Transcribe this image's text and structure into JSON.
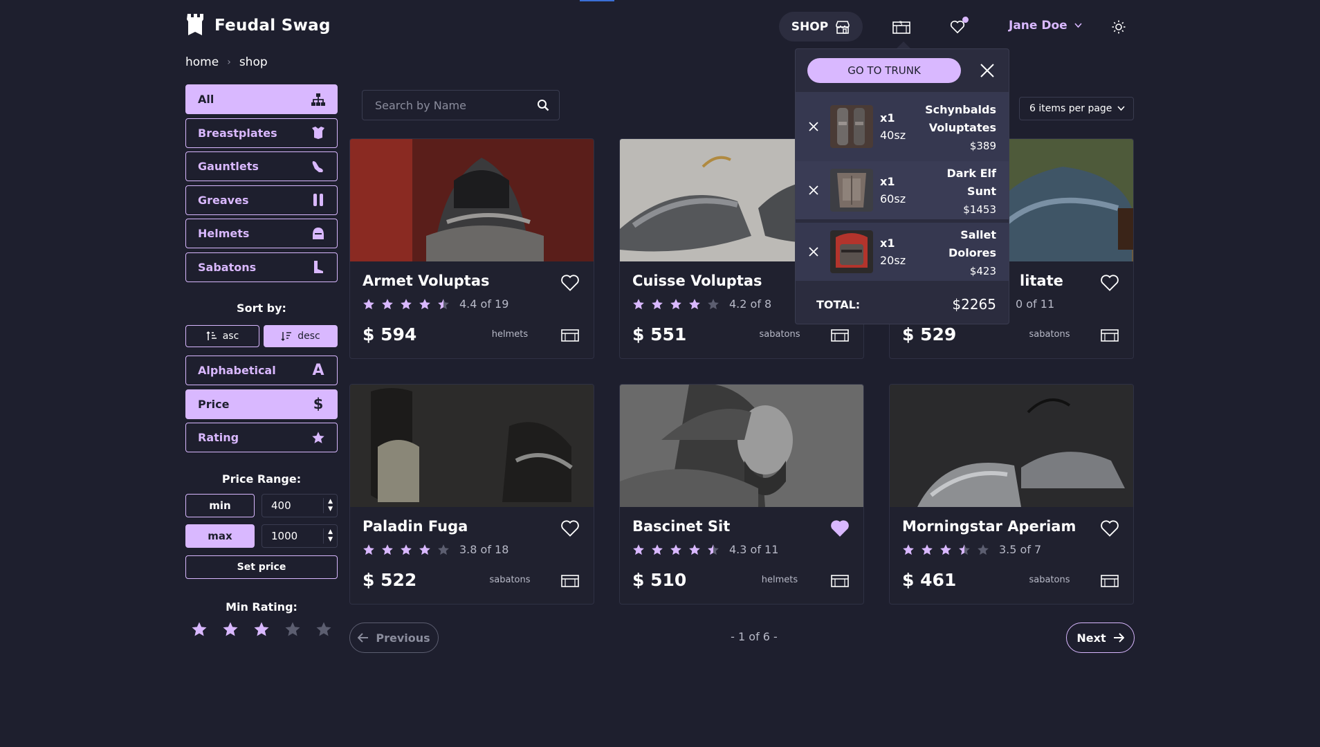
{
  "header": {
    "logo_text": "Feudal Swag",
    "shop_label": "SHOP",
    "trunk_count": "3",
    "user_name": "Jane Doe"
  },
  "breadcrumb": [
    "home",
    "shop"
  ],
  "categories": [
    {
      "label": "All",
      "icon": "hierarchy-icon",
      "active": true
    },
    {
      "label": "Breastplates",
      "icon": "breastplate-icon",
      "active": false
    },
    {
      "label": "Gauntlets",
      "icon": "gauntlet-icon",
      "active": false
    },
    {
      "label": "Greaves",
      "icon": "greaves-icon",
      "active": false
    },
    {
      "label": "Helmets",
      "icon": "helmet-icon",
      "active": false
    },
    {
      "label": "Sabatons",
      "icon": "boot-icon",
      "active": false
    }
  ],
  "sort": {
    "title": "Sort by:",
    "asc_label": "asc",
    "desc_label": "desc",
    "direction": "desc",
    "options": [
      {
        "label": "Alphabetical",
        "icon": "letter-a-icon",
        "active": false
      },
      {
        "label": "Price",
        "icon": "dollar-icon",
        "active": true
      },
      {
        "label": "Rating",
        "icon": "star-icon",
        "active": false
      }
    ]
  },
  "price_range": {
    "title": "Price Range:",
    "min_label": "min",
    "max_label": "max",
    "min_value": "400",
    "max_value": "1000",
    "set_label": "Set price"
  },
  "min_rating": {
    "title": "Min Rating:",
    "value": 3,
    "max": 5
  },
  "search": {
    "placeholder": "Search by Name"
  },
  "per_page": {
    "selected": "6 items per page"
  },
  "products": [
    {
      "name": "Armet Voluptas",
      "rating": 4.4,
      "rating_text": "4.4 of 19",
      "price": "$ 594",
      "category": "helmets",
      "favorite": false
    },
    {
      "name": "Cuisse Voluptas",
      "rating": 4.2,
      "rating_text": "4.2 of 8",
      "price": "$ 551",
      "category": "sabatons",
      "favorite": false
    },
    {
      "name": "litate",
      "rating": 0,
      "rating_text": "0 of 11",
      "price": "$ 529",
      "category": "sabatons",
      "favorite": false
    },
    {
      "name": "Paladin Fuga",
      "rating": 3.8,
      "rating_text": "3.8 of 18",
      "price": "$ 522",
      "category": "sabatons",
      "favorite": false
    },
    {
      "name": "Bascinet Sit",
      "rating": 4.3,
      "rating_text": "4.3 of 11",
      "price": "$ 510",
      "category": "helmets",
      "favorite": true
    },
    {
      "name": "Morningstar Aperiam",
      "rating": 3.5,
      "rating_text": "3.5 of 7",
      "price": "$ 461",
      "category": "sabatons",
      "favorite": false
    }
  ],
  "pagination": {
    "prev_label": "Previous",
    "next_label": "Next",
    "info": "- 1 of 6 -"
  },
  "trunk": {
    "goto_label": "GO TO TRUNK",
    "items": [
      {
        "qty": "x1",
        "size": "40sz",
        "name": "Schynbalds Voluptates",
        "price": "$389"
      },
      {
        "qty": "x1",
        "size": "60sz",
        "name": "Dark Elf Sunt",
        "price": "$1453"
      },
      {
        "qty": "x1",
        "size": "20sz",
        "name": "Sallet Dolores",
        "price": "$423"
      }
    ],
    "total_label": "TOTAL:",
    "total_value": "$2265"
  },
  "colors": {
    "accent": "#d9b8ff",
    "background": "#1e1f2e",
    "star_off": "#5c5e70"
  }
}
